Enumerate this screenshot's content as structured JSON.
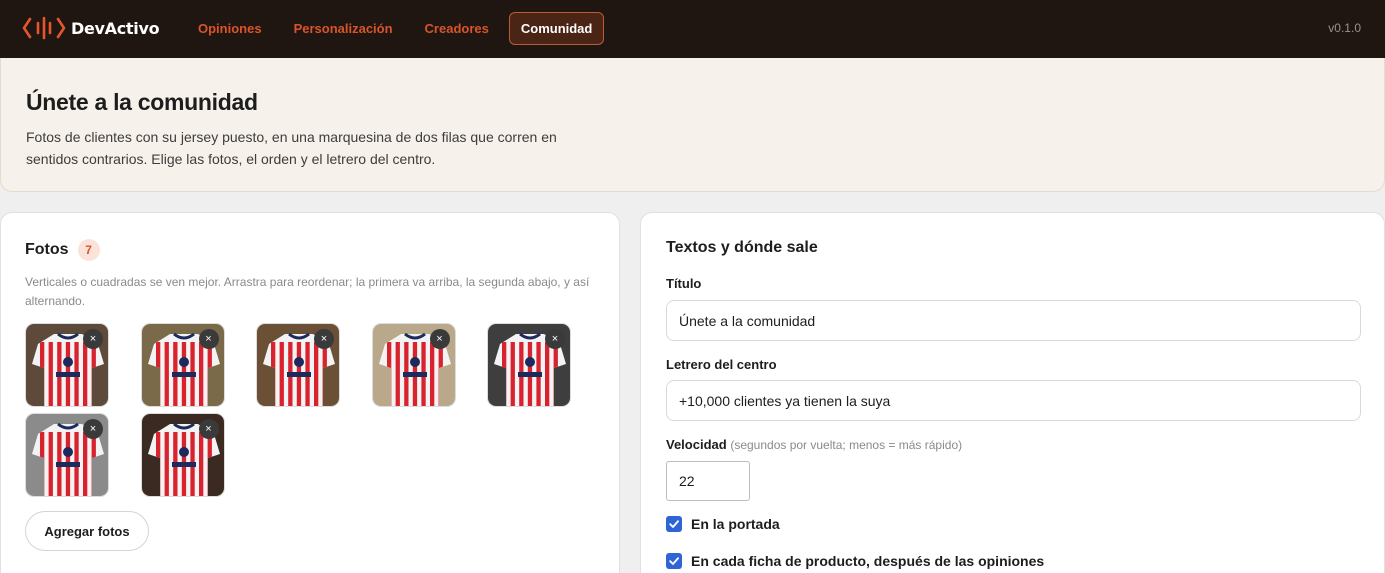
{
  "brand": {
    "name": "DevActivo",
    "accent": "#e4562c"
  },
  "nav": {
    "items": [
      {
        "label": "Opiniones",
        "active": false
      },
      {
        "label": "Personalización",
        "active": false
      },
      {
        "label": "Creadores",
        "active": false
      },
      {
        "label": "Comunidad",
        "active": true
      }
    ]
  },
  "version": "v0.1.0",
  "hero": {
    "title": "Únete a la comunidad",
    "description": "Fotos de clientes con su jersey puesto, en una marquesina de dos filas que corren en sentidos contrarios. Elige las fotos, el orden y el letrero del centro."
  },
  "fotos": {
    "title": "Fotos",
    "count": "7",
    "hint": "Verticales o cuadradas se ven mejor. Arrastra para reordenar; la primera va arriba, la segunda abajo, y así alternando.",
    "remove_icon": "×",
    "photos": [
      {
        "icon": "jersey-photo-icon"
      },
      {
        "icon": "jersey-photo-icon"
      },
      {
        "icon": "jersey-photo-icon"
      },
      {
        "icon": "jersey-photo-icon"
      },
      {
        "icon": "jersey-photo-icon"
      },
      {
        "icon": "jersey-photo-icon"
      },
      {
        "icon": "jersey-photo-icon"
      }
    ],
    "add_label": "Agregar fotos"
  },
  "settings": {
    "title": "Textos y dónde sale",
    "titulo_label": "Título",
    "titulo_value": "Únete a la comunidad",
    "letrero_label": "Letrero del centro",
    "letrero_value": "+10,000 clientes ya tienen la suya",
    "velocidad_label": "Velocidad",
    "velocidad_hint": "(segundos por vuelta; menos = más rápido)",
    "velocidad_value": "22",
    "checks": [
      {
        "label": "En la portada",
        "checked": true
      },
      {
        "label": "En cada ficha de producto, después de las opiniones",
        "checked": true
      }
    ],
    "check_color": "#2f64d6"
  }
}
